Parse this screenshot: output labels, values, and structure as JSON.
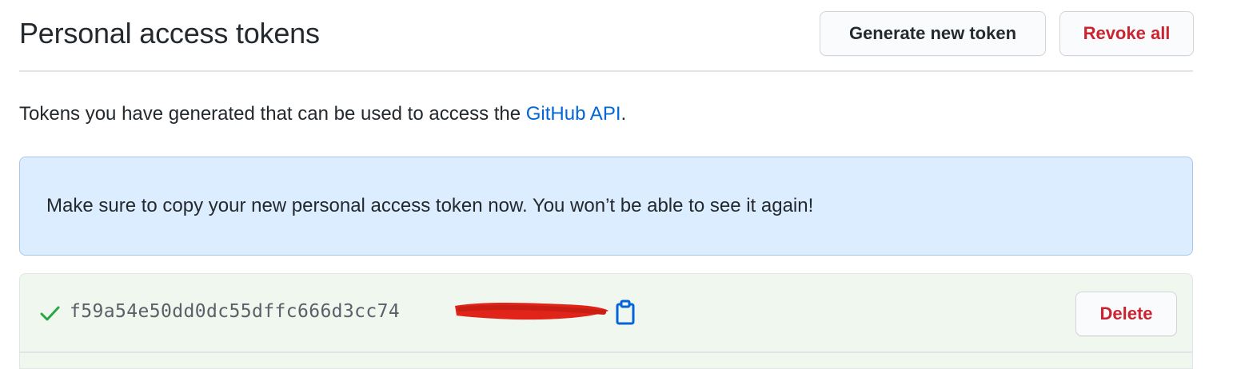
{
  "page": {
    "title": "Personal access tokens"
  },
  "header": {
    "generate_label": "Generate new token",
    "revoke_label": "Revoke all"
  },
  "description": {
    "prefix": "Tokens you have generated that can be used to access the ",
    "link": "GitHub API",
    "suffix": "."
  },
  "flash": {
    "message": "Make sure to copy your new personal access token now. You won’t be able to see it again!"
  },
  "token": {
    "value": "f59a54e50dd0dc55dffc666d3cc74",
    "delete_label": "Delete"
  },
  "colors": {
    "link": "#0366d6",
    "danger": "#cb2431",
    "flash_bg": "#dbedff",
    "token_bg": "#f0f7ee",
    "check": "#28a745",
    "redaction": "#e0241a"
  },
  "icons": {
    "check": "check-icon",
    "copy": "clipboard-icon"
  }
}
